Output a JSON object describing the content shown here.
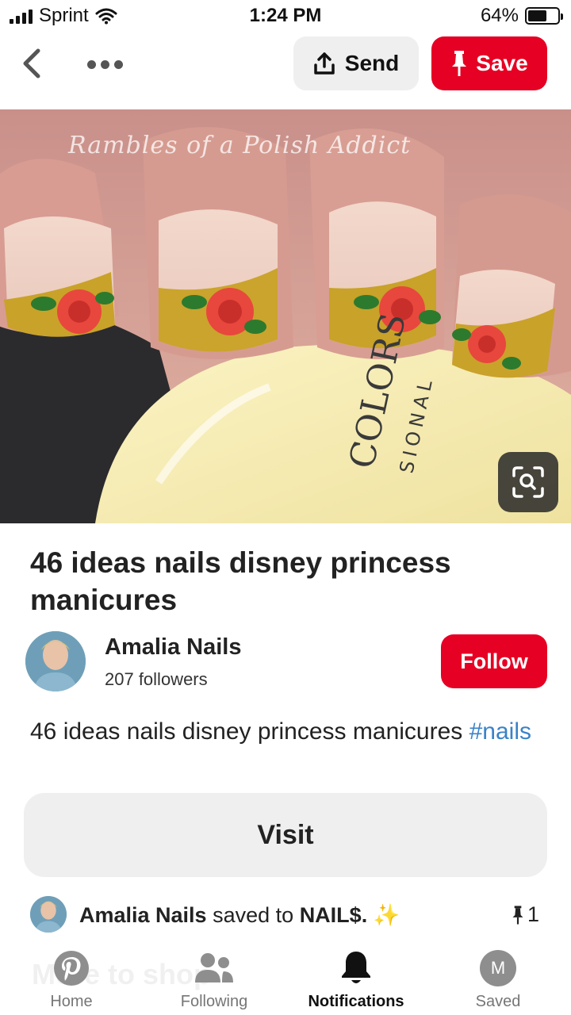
{
  "status_bar": {
    "carrier": "Sprint",
    "time": "1:24 PM",
    "battery": "64%",
    "battery_level": 0.64,
    "icons": [
      "signal-icon",
      "wifi-icon",
      "battery-icon"
    ]
  },
  "nav": {
    "back_icon": "chevron-left-icon",
    "more_icon": "ellipsis-icon",
    "send_label": "Send",
    "send_icon": "share-upload-icon",
    "save_label": "Save",
    "save_icon": "pushpin-icon"
  },
  "pin": {
    "watermark": "Rambles of a Polish Addict",
    "lens_icon": "visual-search-icon",
    "title": "46 ideas nails disney princess manicures",
    "description_text": "46 ideas nails disney princess manicures ",
    "hashtag": "#nails",
    "visit_label": "Visit"
  },
  "creator": {
    "name": "Amalia Nails",
    "followers": "207 followers",
    "follow_label": "Follow"
  },
  "saved_row": {
    "user": "Amalia Nails",
    "saved_to": "saved to",
    "board": "NAIL$.",
    "sparkle": "✨",
    "pin_count": "1"
  },
  "tab_bar": {
    "ghost_text": "More to shop",
    "tabs": [
      {
        "label": "Home",
        "icon": "pinterest-logo-icon"
      },
      {
        "label": "Following",
        "icon": "people-icon"
      },
      {
        "label": "Notifications",
        "icon": "bell-icon"
      },
      {
        "label": "Saved",
        "icon": "profile-avatar-icon",
        "avatar_letter": "M"
      }
    ],
    "active": "Notifications"
  },
  "colors": {
    "brand_red": "#e60023",
    "hashtag_blue": "#3a82c9",
    "button_gray": "#efefef"
  }
}
